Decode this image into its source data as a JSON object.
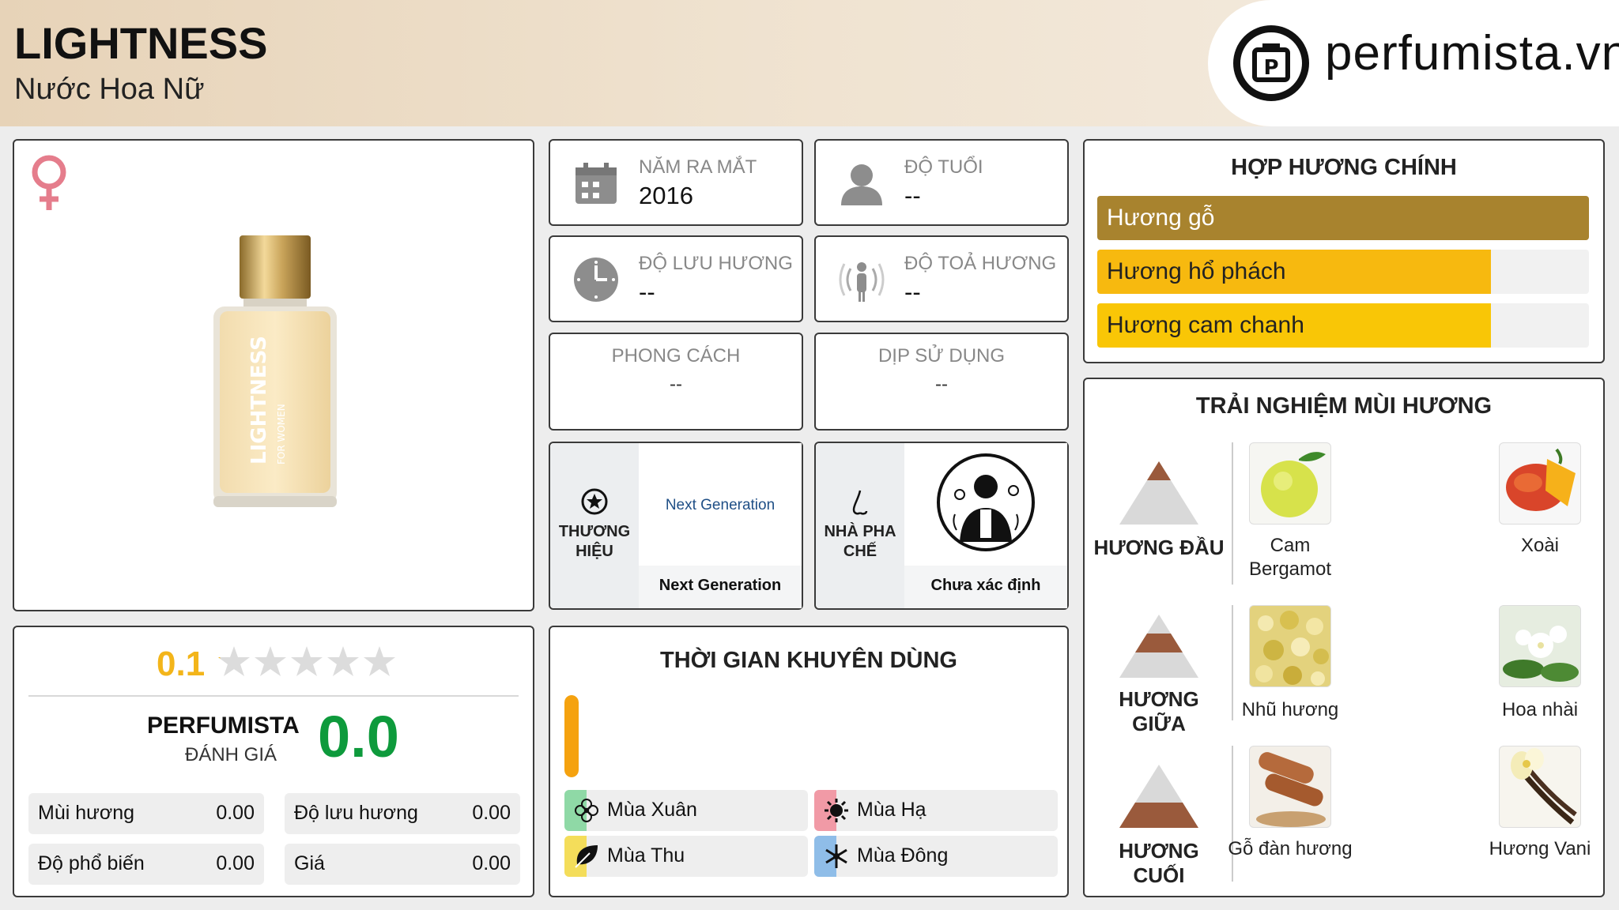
{
  "header": {
    "title": "LIGHTNESS",
    "subtitle": "Nước Hoa Nữ",
    "logo_text": "perfumista.vn"
  },
  "product": {
    "gender_icon": "venus-icon",
    "bottle_text": "LIGHTNESS",
    "bottle_subtext": "FOR WOMEN"
  },
  "info": {
    "release_year": {
      "label": "NĂM RA MẮT",
      "value": "2016",
      "icon": "calendar-icon"
    },
    "age": {
      "label": "ĐỘ TUỔI",
      "value": "--",
      "icon": "person-icon"
    },
    "longevity": {
      "label": "ĐỘ LƯU HƯƠNG",
      "value": "--",
      "icon": "clock-icon"
    },
    "sillage": {
      "label": "ĐỘ TOẢ HƯƠNG",
      "value": "--",
      "icon": "radiate-icon"
    },
    "style": {
      "label": "PHONG CÁCH",
      "value": "--"
    },
    "occasion": {
      "label": "DỊP SỬ DỤNG",
      "value": "--"
    }
  },
  "brand": {
    "label": "THƯƠNG HIỆU",
    "logo_text": "Next Generation",
    "name": "Next Generation"
  },
  "perfumer": {
    "label": "NHÀ PHA CHẾ",
    "name": "Chưa xác định"
  },
  "accords": {
    "title": "HỢP HƯƠNG CHÍNH",
    "items": [
      {
        "label": "Hương gỗ",
        "level": 100,
        "color": "#a8832e"
      },
      {
        "label": "Hương hổ phách",
        "level": 80,
        "color": "#f7b90f"
      },
      {
        "label": "Hương cam chanh",
        "level": 80,
        "color": "#f9c606"
      }
    ]
  },
  "experience": {
    "title": "TRẢI NGHIỆM MÙI HƯƠNG",
    "tiers": [
      {
        "label": "HƯƠNG ĐẦU",
        "notes": [
          "Cam Bergamot",
          "Xoài"
        ]
      },
      {
        "label": "HƯƠNG GIỮA",
        "notes": [
          "Nhũ hương",
          "Hoa nhài"
        ]
      },
      {
        "label": "HƯƠNG CUỐI",
        "notes": [
          "Gỗ đàn hương",
          "Hương Vani"
        ]
      }
    ]
  },
  "rating": {
    "user_score": "0.1",
    "user_stars": 0.02,
    "perfumista_label": "PERFUMISTA",
    "perfumista_sub": "ĐÁNH GIÁ",
    "perfumista_score": "0.0",
    "metrics": [
      {
        "label": "Mùi hương",
        "value": "0.00"
      },
      {
        "label": "Độ lưu hương",
        "value": "0.00"
      },
      {
        "label": "Độ phổ biến",
        "value": "0.00"
      },
      {
        "label": "Giá",
        "value": "0.00"
      }
    ]
  },
  "seasons": {
    "title": "THỜI GIAN KHUYÊN DÙNG",
    "day_night_level": 1.0,
    "items": [
      {
        "label": "Mùa Xuân",
        "icon": "flower-icon",
        "color": "#8fd9a6"
      },
      {
        "label": "Mùa Hạ",
        "icon": "sun-icon",
        "color": "#f19aa6"
      },
      {
        "label": "Mùa Thu",
        "icon": "leaf-icon",
        "color": "#f4dd5a"
      },
      {
        "label": "Mùa Đông",
        "icon": "snowflake-icon",
        "color": "#8fbde8"
      }
    ]
  }
}
